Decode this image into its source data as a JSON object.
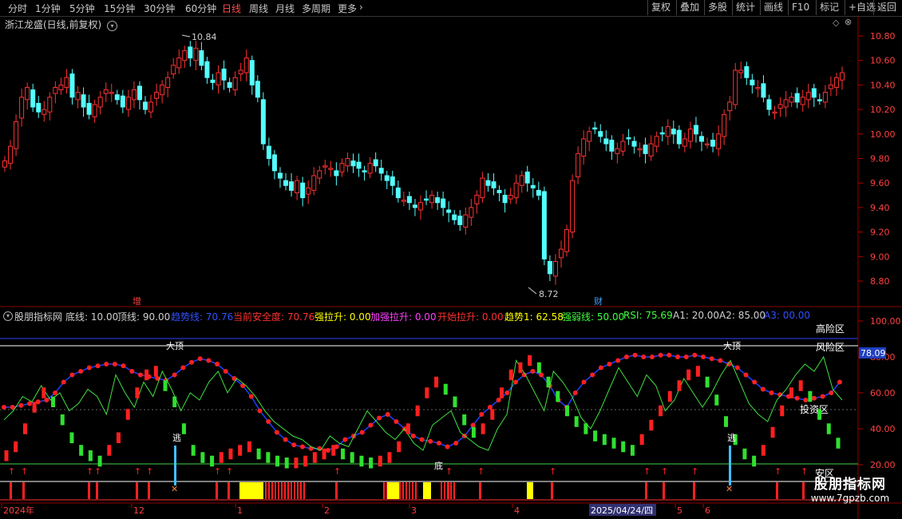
{
  "toolbar": {
    "periods": [
      "分时",
      "1分钟",
      "5分钟",
      "15分钟",
      "30分钟",
      "60分钟",
      "日线",
      "周线",
      "月线",
      "多周期",
      "更多"
    ],
    "active_period": "日线",
    "more_icon": "chevron-right-icon",
    "right_buttons": [
      "复权",
      "叠加",
      "多股",
      "统计",
      "画线",
      "F10",
      "标记",
      "+自选",
      "返回"
    ]
  },
  "chart_header": {
    "title": "浙江龙盛(日线,前复权)",
    "dropdown_icon": "chevron-down-circle-icon",
    "diamond_icon": "diamond-icon",
    "close_icon": "close-circle-icon"
  },
  "price_axis": {
    "ticks": [
      "10.80",
      "10.60",
      "10.40",
      "10.20",
      "10.00",
      "9.80",
      "9.60",
      "9.40",
      "9.20",
      "9.00",
      "8.80"
    ],
    "range": [
      8.72,
      10.84
    ]
  },
  "price_annotations": {
    "high_label": "10.84",
    "low_label": "8.72",
    "marker_zeng": "增",
    "marker_cai": "财"
  },
  "indicator_legend": [
    {
      "text": "股朋指标网",
      "color": "#d0d0d0"
    },
    {
      "text": "底线: 10.00",
      "color": "#d0d0d0"
    },
    {
      "text": "顶线: 90.00",
      "color": "#d0d0d0"
    },
    {
      "text": "趋势线: 70.76",
      "color": "#3050ff"
    },
    {
      "text": "当前安全度: 70.76",
      "color": "#ff3030"
    },
    {
      "text": "强拉升: 0.00",
      "color": "#ffff00"
    },
    {
      "text": "加强拉升: 0.00",
      "color": "#ff40ff"
    },
    {
      "text": "开始拉升: 0.00",
      "color": "#ff3030"
    },
    {
      "text": "趋势1: 62.58",
      "color": "#ffff00"
    },
    {
      "text": "强弱线: 50.00",
      "color": "#40ff40"
    },
    {
      "text": "RSI: 75.69",
      "color": "#40ff40"
    },
    {
      "text": "A1: 20.00",
      "color": "#d0d0d0"
    },
    {
      "text": "A2: 85.00",
      "color": "#d0d0d0"
    },
    {
      "text": "A3: 00.00",
      "color": "#3050ff"
    }
  ],
  "indicator_axis": {
    "ticks": [
      "100.00",
      "80.00",
      "60.00",
      "40.00",
      "20.00"
    ],
    "current_value": "78.09"
  },
  "zone_labels": {
    "high_risk": "高险区",
    "risk": "风险区",
    "invest": "投资区",
    "safe": "安区"
  },
  "signal_labels": {
    "top1": "大顶",
    "top2": "大顶",
    "escape": "逃",
    "bottom": "底"
  },
  "date_axis": {
    "labels": [
      "2024年",
      "12",
      "1",
      "2",
      "3",
      "4",
      "2025/04/24/四",
      "5",
      "6"
    ]
  },
  "watermark": {
    "line1": "股朋指标网",
    "line2": "www.7gpzb.com"
  },
  "colors": {
    "up": "#ff3232",
    "down": "#54ffff",
    "ma": "#ffffff",
    "trend_dots": "#ff2020",
    "blue_line": "#2040ff",
    "green_line": "#40e040"
  }
}
